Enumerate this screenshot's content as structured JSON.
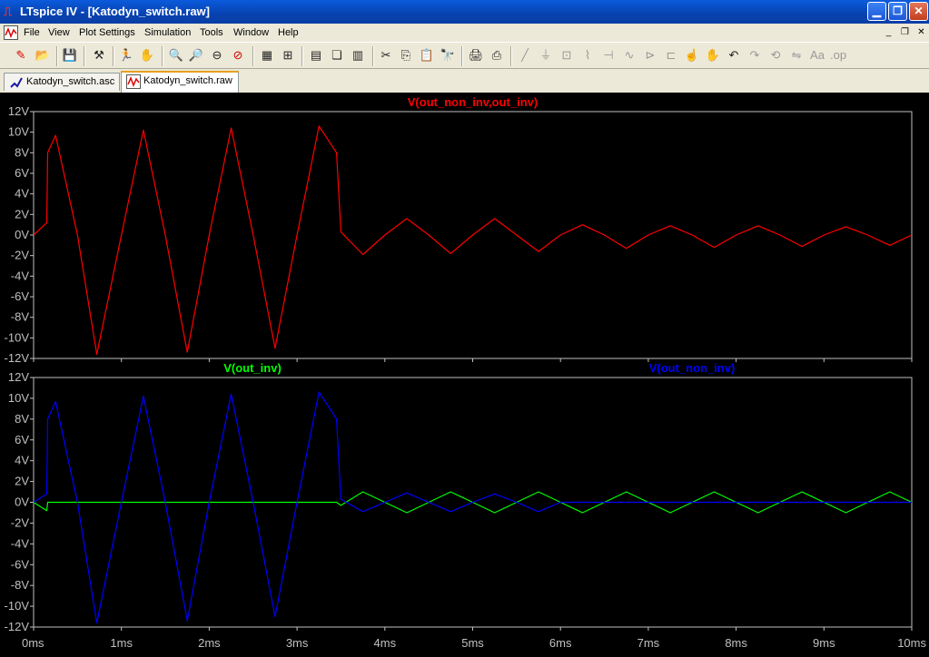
{
  "window": {
    "title": "LTspice IV - [Katodyn_switch.raw]"
  },
  "menu": [
    "File",
    "View",
    "Plot Settings",
    "Simulation",
    "Tools",
    "Window",
    "Help"
  ],
  "tabs": [
    {
      "label": "Katodyn_switch.asc",
      "icon": "schematic-icon",
      "active": false
    },
    {
      "label": "Katodyn_switch.raw",
      "icon": "waveform-icon",
      "active": true
    }
  ],
  "colors": {
    "trace_diff": "#ff0000",
    "trace_inv": "#00ff00",
    "trace_non_inv": "#0000ff",
    "plot_bg": "#000000",
    "axes": "#c0c0c0"
  },
  "chart_data": [
    {
      "type": "line",
      "title": "V(out_non_inv,out_inv)",
      "xlim": [
        0,
        10
      ],
      "x_unit": "ms",
      "ylim": [
        -12,
        12
      ],
      "y_unit": "V",
      "x_ticks": [
        "0ms",
        "1ms",
        "2ms",
        "3ms",
        "4ms",
        "5ms",
        "6ms",
        "7ms",
        "8ms",
        "9ms",
        "10ms"
      ],
      "y_ticks": [
        "12V",
        "10V",
        "8V",
        "6V",
        "4V",
        "2V",
        "0V",
        "-2V",
        "-4V",
        "-6V",
        "-8V",
        "-10V",
        "-12V"
      ],
      "series": [
        {
          "name": "V(out_non_inv,out_inv)",
          "color": "#ff0000",
          "x": [
            0,
            0.15,
            0.16,
            0.25,
            0.5,
            0.72,
            1.0,
            1.25,
            1.5,
            1.75,
            2.0,
            2.25,
            2.5,
            2.75,
            3.0,
            3.25,
            3.45,
            3.5,
            3.75,
            4.0,
            4.25,
            4.5,
            4.75,
            5.0,
            5.25,
            5.5,
            5.75,
            6.0,
            6.25,
            6.5,
            6.75,
            7.0,
            7.25,
            7.5,
            7.75,
            8.0,
            8.25,
            8.5,
            8.75,
            9.0,
            9.25,
            9.5,
            9.75,
            10.0
          ],
          "y": [
            0,
            1.2,
            8.0,
            9.7,
            0,
            -11.6,
            0,
            10.2,
            0,
            -11.4,
            0,
            10.4,
            0,
            -11.0,
            0,
            10.6,
            8.0,
            0.3,
            -1.9,
            0,
            1.6,
            0,
            -1.8,
            0,
            1.6,
            0,
            -1.6,
            0,
            1.0,
            0,
            -1.3,
            0,
            0.9,
            0,
            -1.2,
            0,
            0.9,
            0,
            -1.1,
            0,
            0.8,
            0,
            -1.0,
            0
          ]
        }
      ]
    },
    {
      "type": "line",
      "xlim": [
        0,
        10
      ],
      "x_unit": "ms",
      "ylim": [
        -12,
        12
      ],
      "y_unit": "V",
      "x_ticks": [
        "0ms",
        "1ms",
        "2ms",
        "3ms",
        "4ms",
        "5ms",
        "6ms",
        "7ms",
        "8ms",
        "9ms",
        "10ms"
      ],
      "y_ticks": [
        "12V",
        "10V",
        "8V",
        "6V",
        "4V",
        "2V",
        "0V",
        "-2V",
        "-4V",
        "-6V",
        "-8V",
        "-10V",
        "-12V"
      ],
      "series": [
        {
          "name": "V(out_inv)",
          "color": "#00ff00",
          "x": [
            0,
            0.15,
            0.16,
            3.45,
            3.5,
            3.75,
            4.0,
            4.25,
            4.5,
            4.75,
            5.0,
            5.25,
            5.5,
            5.75,
            6.0,
            6.25,
            6.5,
            6.75,
            7.0,
            7.25,
            7.5,
            7.75,
            8.0,
            8.25,
            8.5,
            8.75,
            9.0,
            9.25,
            9.5,
            9.75,
            10.0
          ],
          "y": [
            0,
            -0.8,
            0,
            0,
            -0.3,
            1.0,
            0,
            -1.0,
            0,
            1.0,
            0,
            -1.0,
            0,
            1.0,
            0,
            -1.0,
            0,
            1.0,
            0,
            -1.0,
            0,
            1.0,
            0,
            -1.0,
            0,
            1.0,
            0,
            -1.0,
            0,
            1.0,
            0
          ]
        },
        {
          "name": "V(out_non_inv)",
          "color": "#0000ff",
          "x": [
            0,
            0.15,
            0.16,
            0.25,
            0.5,
            0.72,
            1.0,
            1.25,
            1.5,
            1.75,
            2.0,
            2.25,
            2.5,
            2.75,
            3.0,
            3.25,
            3.45,
            3.5,
            3.75,
            4.0,
            4.25,
            4.5,
            4.75,
            5.0,
            5.25,
            5.5,
            5.75,
            6.0,
            10.0
          ],
          "y": [
            0,
            0.8,
            8.0,
            9.7,
            0,
            -11.6,
            0,
            10.2,
            0,
            -11.4,
            0,
            10.4,
            0,
            -11.0,
            0,
            10.6,
            8.0,
            0.3,
            -0.9,
            0,
            0.9,
            0,
            -0.9,
            0,
            0.8,
            0,
            -0.9,
            0,
            0
          ]
        }
      ]
    }
  ]
}
